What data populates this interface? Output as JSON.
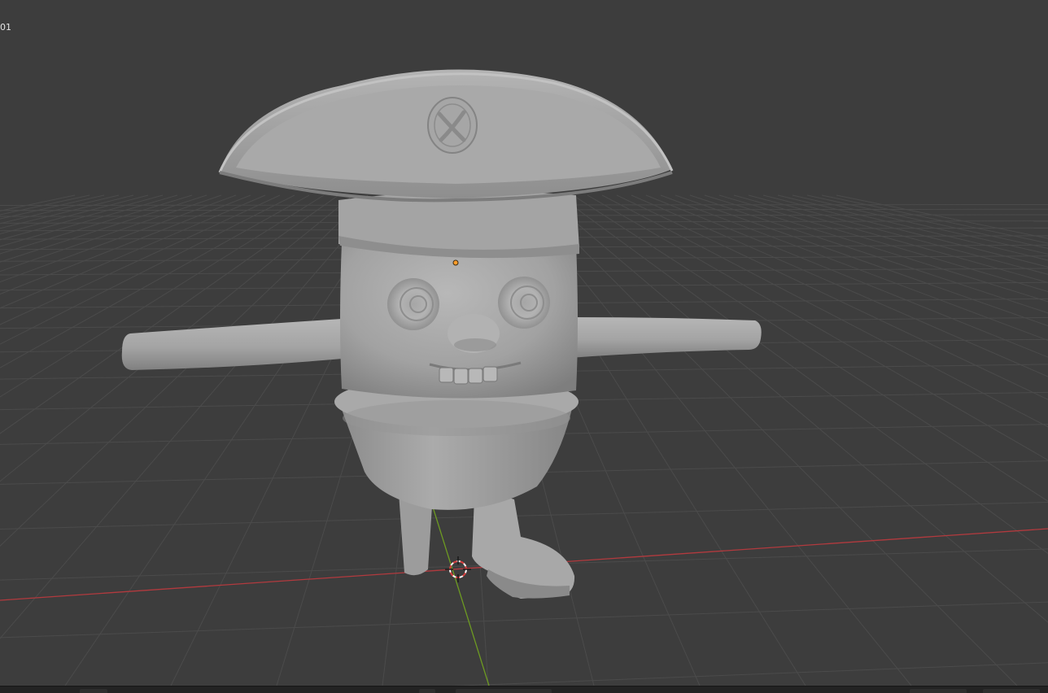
{
  "viewport": {
    "object_info_label": "01",
    "colors": {
      "background": "#3d3d3d",
      "grid": "#4a4a4a",
      "x_axis": "#b23a3e",
      "y_axis": "#6d9a22",
      "model": "#a8a8a8",
      "origin": "#ff9d2a",
      "cursor": "#d93f3f"
    },
    "model": "pirate-character-sculpt"
  }
}
